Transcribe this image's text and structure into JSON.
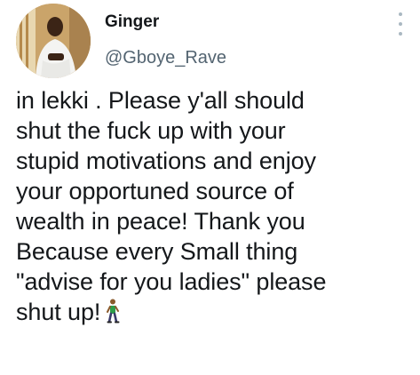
{
  "tweet": {
    "display_name": "Ginger",
    "handle": "@Gboye_Rave",
    "text": "in lekki . Please y'all should\nshut the fuck up with your\nstupid motivations and enjoy\nyour opportuned source of\nwealth in peace! Thank you\nBecause every Small thing\n\"advise for you ladies\" please\nshut up!",
    "emoji_icon": "person-walking-icon",
    "more_icon": "vertical-ellipsis-icon"
  }
}
